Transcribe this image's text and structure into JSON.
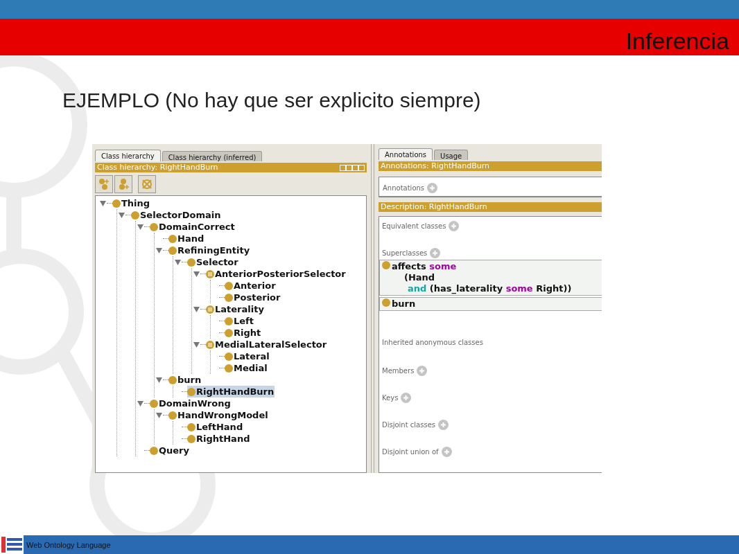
{
  "slide": {
    "title": "Inferencia",
    "subtitle": "EJEMPLO (No hay que ser explicito siempre)",
    "footer": "Web Ontology Language"
  },
  "left_pane": {
    "tabs": [
      {
        "label": "Class hierarchy",
        "selected": true
      },
      {
        "label": "Class hierarchy (inferred)",
        "selected": false
      }
    ],
    "header": "Class hierarchy: RightHandBurn",
    "tree": [
      {
        "label": "Thing",
        "kind": "class",
        "expanded": true,
        "selected": false,
        "children": [
          {
            "label": "SelectorDomain",
            "kind": "class",
            "expanded": true,
            "selected": false,
            "children": [
              {
                "label": "DomainCorrect",
                "kind": "class",
                "expanded": true,
                "selected": false,
                "children": [
                  {
                    "label": "Hand",
                    "kind": "class",
                    "selected": false
                  },
                  {
                    "label": "RefiningEntity",
                    "kind": "class",
                    "expanded": true,
                    "selected": false,
                    "children": [
                      {
                        "label": "Selector",
                        "kind": "class",
                        "expanded": true,
                        "selected": false,
                        "children": [
                          {
                            "label": "AnteriorPosteriorSelector",
                            "kind": "defined",
                            "expanded": true,
                            "selected": false,
                            "children": [
                              {
                                "label": "Anterior",
                                "kind": "class",
                                "selected": false
                              },
                              {
                                "label": "Posterior",
                                "kind": "class",
                                "selected": false
                              }
                            ]
                          },
                          {
                            "label": "Laterality",
                            "kind": "defined",
                            "expanded": true,
                            "selected": false,
                            "children": [
                              {
                                "label": "Left",
                                "kind": "class",
                                "selected": false
                              },
                              {
                                "label": "Right",
                                "kind": "class",
                                "selected": false
                              }
                            ]
                          },
                          {
                            "label": "MedialLateralSelector",
                            "kind": "defined",
                            "expanded": true,
                            "selected": false,
                            "children": [
                              {
                                "label": "Lateral",
                                "kind": "class",
                                "selected": false
                              },
                              {
                                "label": "Medial",
                                "kind": "class",
                                "selected": false
                              }
                            ]
                          }
                        ]
                      }
                    ]
                  },
                  {
                    "label": "burn",
                    "kind": "class",
                    "expanded": true,
                    "selected": false,
                    "children": [
                      {
                        "label": "RightHandBurn",
                        "kind": "class",
                        "selected": true
                      }
                    ]
                  }
                ]
              },
              {
                "label": "DomainWrong",
                "kind": "class",
                "expanded": true,
                "selected": false,
                "children": [
                  {
                    "label": "HandWrongModel",
                    "kind": "class",
                    "expanded": true,
                    "selected": false,
                    "children": [
                      {
                        "label": "LeftHand",
                        "kind": "class",
                        "selected": false
                      },
                      {
                        "label": "RightHand",
                        "kind": "class",
                        "selected": false
                      }
                    ]
                  }
                ]
              },
              {
                "label": "Query",
                "kind": "class",
                "selected": false
              }
            ]
          }
        ]
      }
    ]
  },
  "right_pane": {
    "tabs": [
      {
        "label": "Annotations",
        "selected": true
      },
      {
        "label": "Usage",
        "selected": false
      }
    ],
    "annotations_header": "Annotations: RightHandBurn",
    "annotations_label": "Annotations",
    "description_header": "Description: RightHandBurn",
    "sections": [
      {
        "label": "Equivalent classes",
        "addable": true
      },
      {
        "label": "Superclasses",
        "addable": true,
        "items": [
          {
            "lines": [
              [
                {
                  "text": "affects ",
                  "kind": "name"
                },
                {
                  "text": "some",
                  "kind": "quantifier"
                }
              ],
              [
                {
                  "text": "(Hand",
                  "kind": "name"
                }
              ],
              [
                {
                  "text": "and",
                  "kind": "connective"
                },
                {
                  "text": " (has_laterality ",
                  "kind": "name"
                },
                {
                  "text": "some",
                  "kind": "quantifier"
                },
                {
                  "text": " Right))",
                  "kind": "name"
                }
              ]
            ]
          },
          {
            "lines": [
              [
                {
                  "text": "burn",
                  "kind": "name"
                }
              ]
            ]
          }
        ]
      },
      {
        "label": "Inherited anonymous classes",
        "addable": false
      },
      {
        "label": "Members",
        "addable": true
      },
      {
        "label": "Keys",
        "addable": true
      },
      {
        "label": "Disjoint classes",
        "addable": true
      },
      {
        "label": "Disjoint union of",
        "addable": true
      }
    ]
  }
}
